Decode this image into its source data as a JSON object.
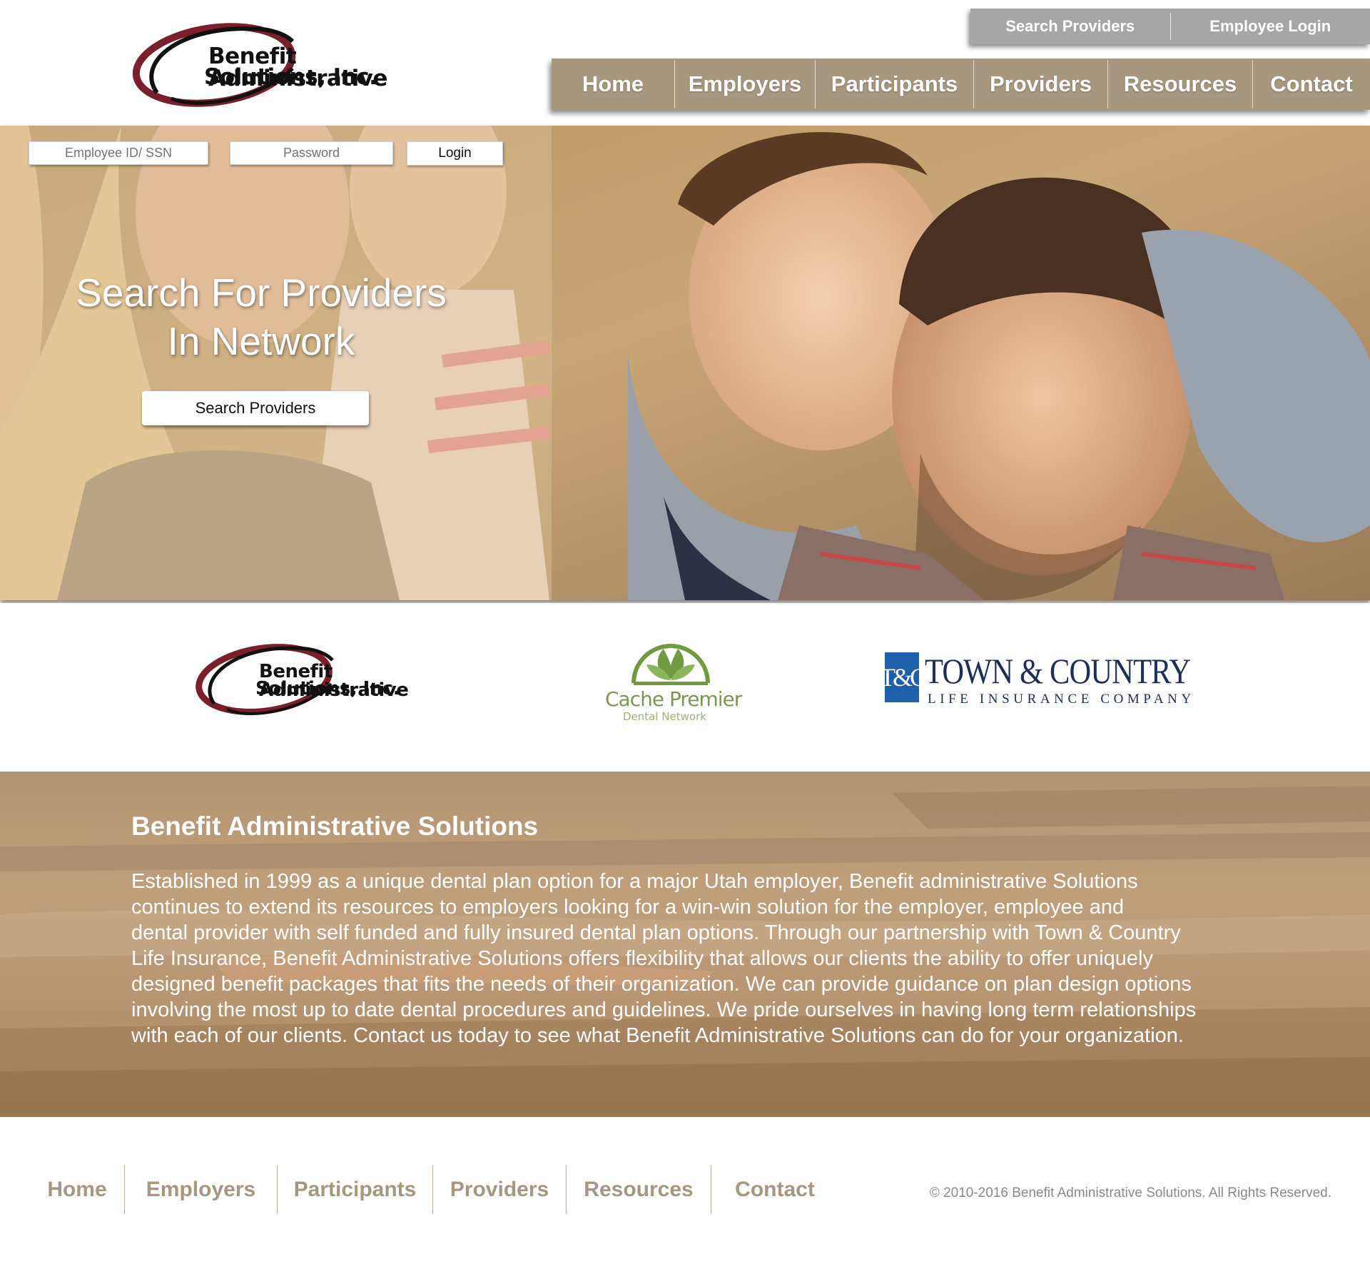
{
  "brand": {
    "line1": "Benefit Administrative",
    "line2": "Solutions, Inc.",
    "colors": {
      "maroon": "#7b1f2b",
      "black": "#111111",
      "taupe": "#a8977e",
      "gray_bar": "#a6a6a6"
    }
  },
  "top_bar": {
    "search_providers": "Search Providers",
    "employee_login": "Employee Login"
  },
  "main_nav": [
    "Home",
    "Employers",
    "Participants",
    "Providers",
    "Resources",
    "Contact"
  ],
  "login": {
    "id_placeholder": "Employee ID/ SSN",
    "password_placeholder": "Password",
    "button": "Login"
  },
  "hero": {
    "heading_line1": "Search For Providers",
    "heading_line2": "In Network",
    "button": "Search Providers"
  },
  "partners": {
    "bas_line1": "Benefit Administrative",
    "bas_line2": "Solutions, Inc.",
    "cache_name": "Cache Premier",
    "cache_sub": "Dental Network",
    "tc_monogram": "T&C",
    "tc_title": "TOWN & COUNTRY",
    "tc_sub": "LIFE INSURANCE COMPANY"
  },
  "about": {
    "title": "Benefit Administrative Solutions",
    "lines": [
      "Established in 1999 as a unique dental plan option for a major Utah employer, Benefit administrative Solutions",
      "continues to extend its resources to employers looking for a win-win solution for the employer, employee and",
      "dental provider with self funded and fully insured dental plan options. Through our partnership with Town & Country",
      "Life Insurance, Benefit Administrative Solutions offers flexibility that allows our clients the ability to offer uniquely",
      "designed benefit packages that fits the needs of their organization. We can provide guidance on plan design options",
      "involving the most up to date dental procedures and guidelines. We pride ourselves in having long term relationships",
      "with each of our clients. Contact us today to see what Benefit Administrative Solutions can do for your organization."
    ]
  },
  "footer": {
    "nav": [
      "Home",
      "Employers",
      "Participants",
      "Providers",
      "Resources",
      "Contact"
    ],
    "copyright": "© 2010-2016 Benefit Administrative Solutions. All Rights Reserved."
  }
}
